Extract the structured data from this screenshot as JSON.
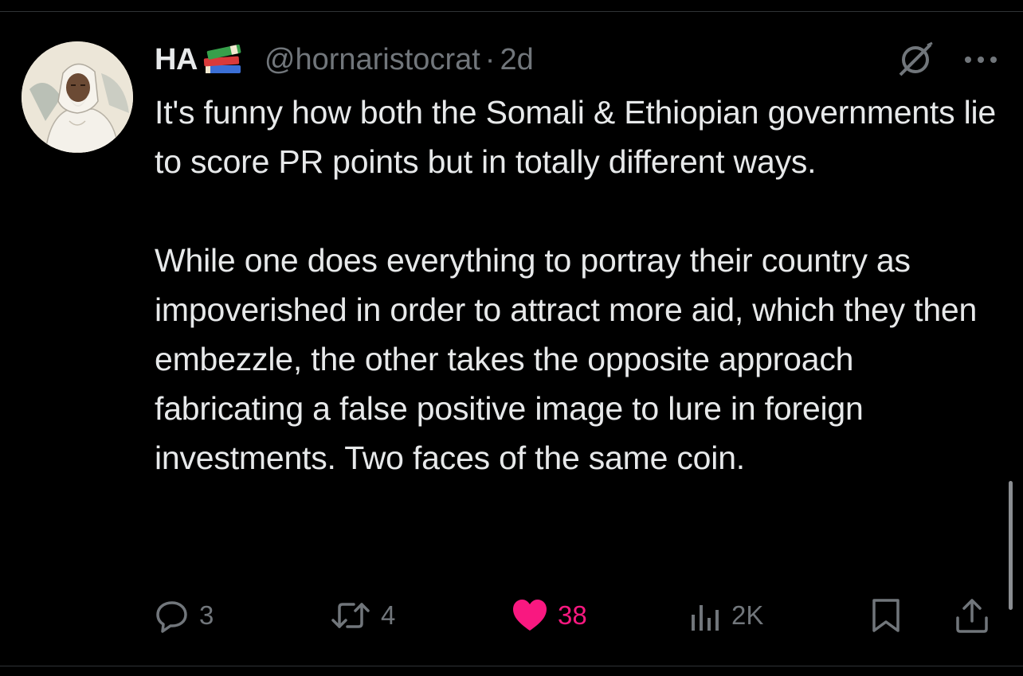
{
  "tweet": {
    "author_name": "HA",
    "handle": "@hornaristocrat",
    "separator": "·",
    "time": "2d",
    "body_paragraphs": [
      "It's funny how both the Somali & Ethiopian governments lie to score PR points but in totally different ways.",
      "While one does everything to portray their country as impoverished in order to attract more aid, which they then embezzle, the other takes the opposite approach fabricating a false positive image to lure in foreign investments. Two faces of the same coin."
    ],
    "name_emoji": "books-icon"
  },
  "actions": {
    "reply_count": "3",
    "retweet_count": "4",
    "like_count": "38",
    "views_count": "2K",
    "liked": true
  },
  "colors": {
    "background": "#000000",
    "text": "#e7e9ea",
    "muted": "#71767b",
    "like": "#f91880",
    "divider": "#2f3336"
  },
  "icons": [
    "reply-icon",
    "retweet-icon",
    "heart-icon",
    "views-icon",
    "bookmark-icon",
    "share-icon",
    "grok-icon",
    "more-icon"
  ]
}
